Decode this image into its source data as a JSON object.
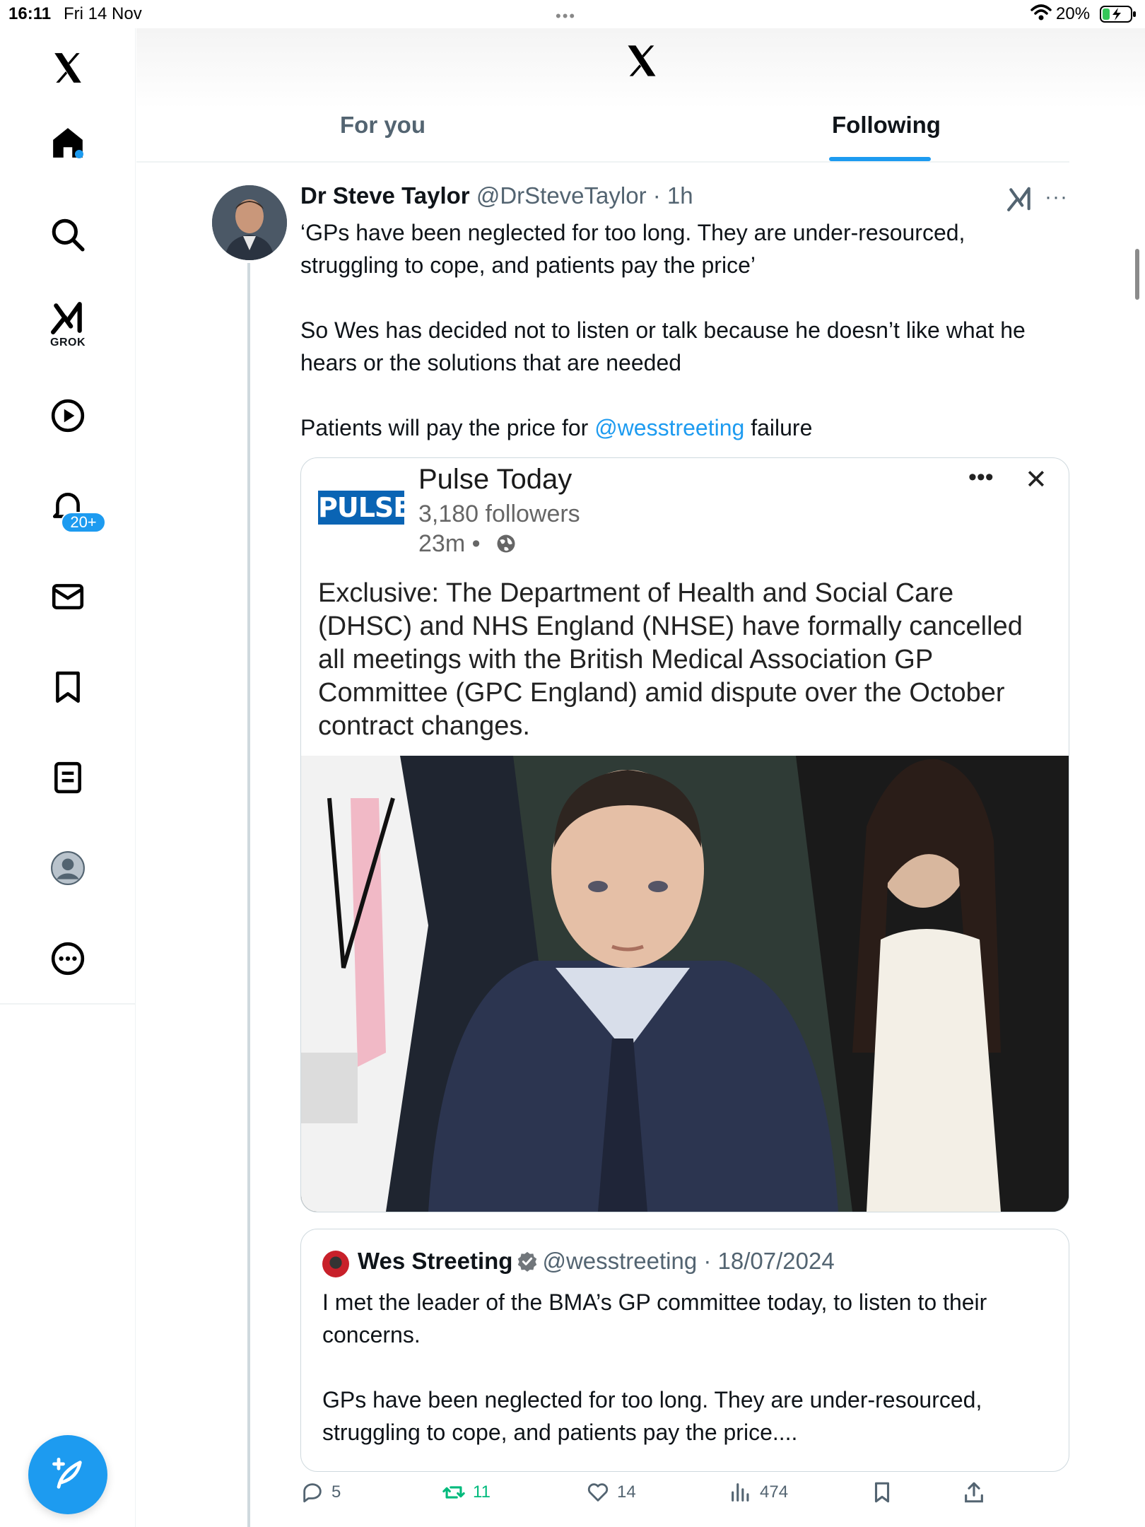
{
  "status_bar": {
    "time": "16:11",
    "date": "Fri 14 Nov",
    "battery": "20%"
  },
  "sidebar": {
    "grok_label": "GROK",
    "notifications_badge": "20+"
  },
  "header": {
    "tabs": [
      {
        "label": "For you"
      },
      {
        "label": "Following"
      }
    ],
    "active_tab": "Following"
  },
  "tweet": {
    "author_name": "Dr Steve Taylor",
    "handle": "@DrSteveTaylor",
    "time": "1h",
    "text_para1": "‘GPs have been neglected for too long. They are under-resourced, struggling to cope, and patients pay the price’",
    "text_para2": "So Wes has decided not to listen or talk because he doesn’t like what he hears or the solutions that are needed",
    "text_para3_before": "Patients will pay the price for ",
    "text_para3_mention": "@wesstreeting",
    "text_para3_after": " failure",
    "embed": {
      "logo_text": "PULSE",
      "name": "Pulse Today",
      "followers": "3,180 followers",
      "time": "23m •",
      "text": "Exclusive: The Department of Health and Social Care (DHSC) and NHS England (NHSE) have formally cancelled all meetings with the British Medical Association GP Committee (GPC England) amid dispute over the October contract changes."
    },
    "quote": {
      "author_name": "Wes Streeting",
      "handle": "@wesstreeting",
      "date": "18/07/2024",
      "text_para1": "I met the leader of the BMA’s GP committee today, to listen to their concerns.",
      "text_para2": "GPs have been neglected for too long. They are under-resourced, struggling to cope, and patients pay the price...."
    },
    "actions": {
      "replies": "5",
      "reposts": "11",
      "likes": "14",
      "views": "474"
    }
  },
  "colors": {
    "accent": "#1d9bf0",
    "repost": "#00ba7c",
    "pulse_blue": "#0a64b4"
  }
}
